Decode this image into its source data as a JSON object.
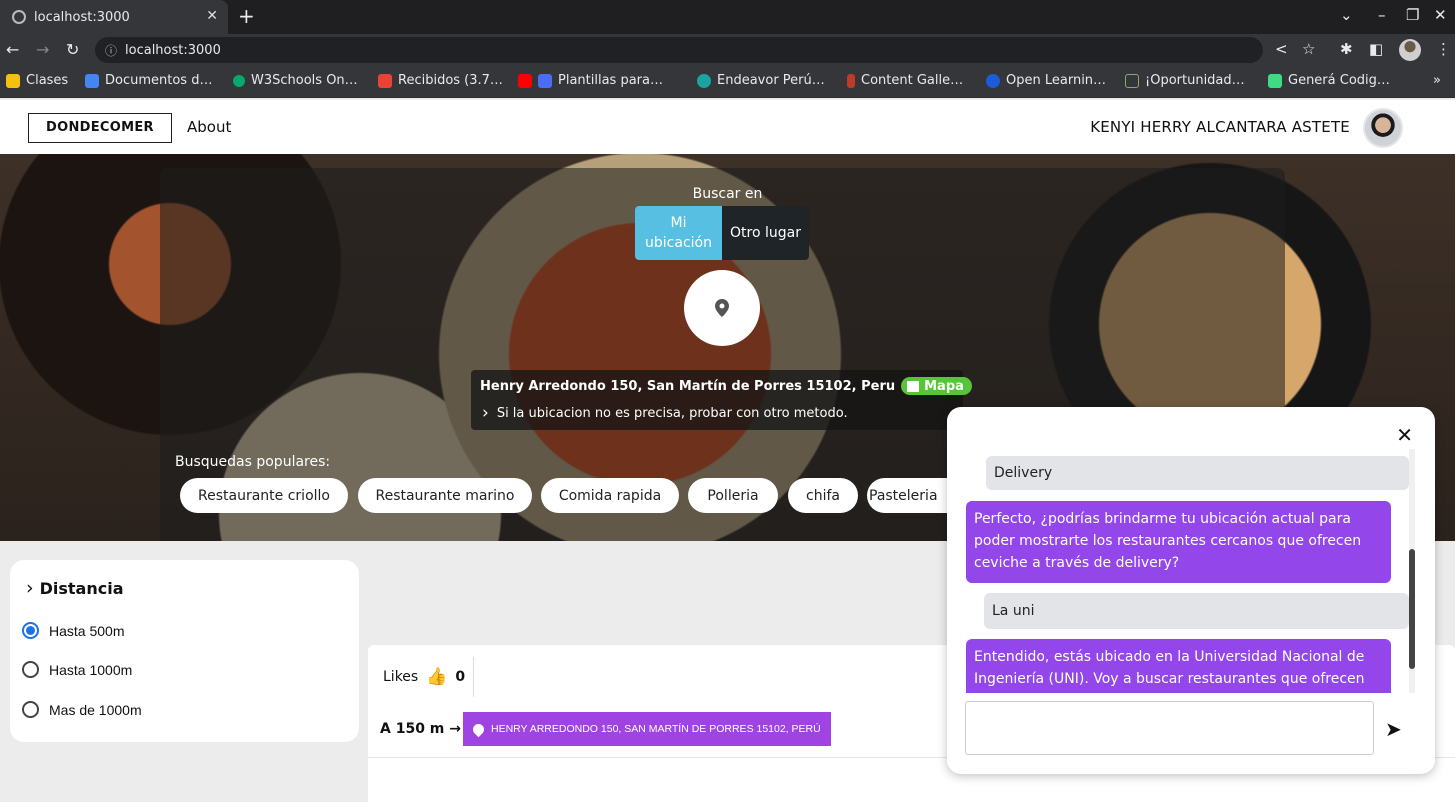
{
  "browser": {
    "tab_title": "localhost:3000",
    "new_tab": "+",
    "url": "localhost:3000",
    "bookmarks": [
      "Clases",
      "Documentos d…",
      "W3Schools On…",
      "Recibidos (3.7…",
      "Plantillas para…",
      "Endeavor Perú…",
      "Content Galle…",
      "Open Learnin…",
      "¡Oportunidad…",
      "Generá Codig…"
    ]
  },
  "navbar": {
    "brand": "DONDECOMER",
    "about": "About",
    "user_name": "KENYI HERRY ALCANTARA ASTETE"
  },
  "hero": {
    "buscar_en": "Buscar en",
    "mode_selected": "Mi ubicación",
    "mode_other": "Otro lugar",
    "address": "Henry Arredondo 150, San Martín de Porres 15102, Peru",
    "map_badge": "Mapa",
    "hint": "Si la ubicacion no es precisa, probar con otro metodo.",
    "popular_label": "Busquedas populares:",
    "popular": [
      "Restaurante criollo",
      "Restaurante marino",
      "Comida rapida",
      "Polleria",
      "chifa",
      "Pasteleria"
    ]
  },
  "filters": {
    "title": "Distancia",
    "options": [
      "Hasta 500m",
      "Hasta 1000m",
      "Mas de 1000m"
    ],
    "selected": "Hasta 500m"
  },
  "result": {
    "likes_label": "Likes",
    "likes_count": "0",
    "distance": "A 150 m",
    "address_tag": "HENRY ARREDONDO 150, SAN MARTÍN DE PORRES 15102, PERÚ"
  },
  "chat": {
    "messages": [
      {
        "role": "user",
        "text": "Delivery"
      },
      {
        "role": "bot",
        "text": "Perfecto, ¿podrías brindarme tu ubicación actual para poder mostrarte los restaurantes cercanos que ofrecen ceviche a través de delivery?"
      },
      {
        "role": "user",
        "text": "La uni"
      },
      {
        "role": "bot",
        "text": "Entendido, estás ubicado en la Universidad Nacional de Ingeniería (UNI). Voy a buscar restaurantes que ofrecen"
      }
    ],
    "input_value": ""
  },
  "colors": {
    "accent_purple": "#9346ea",
    "segment_active": "#56bfe2",
    "map_badge": "#58c43a",
    "radio_checked": "#1a73e8"
  }
}
